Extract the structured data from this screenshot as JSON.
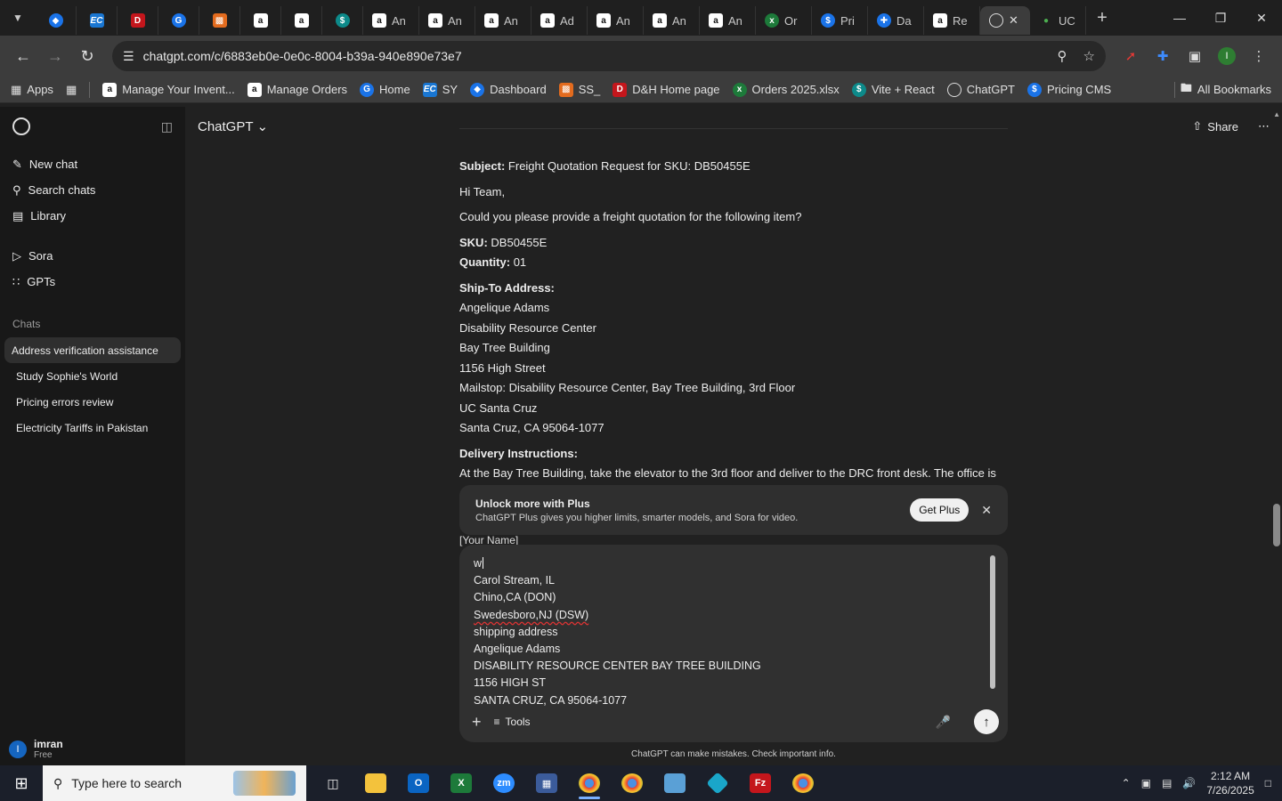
{
  "browser": {
    "tabs": [
      {
        "icon": "blue-diamond-icon",
        "label": ""
      },
      {
        "icon": "ec-icon",
        "label": ""
      },
      {
        "icon": "dh-icon",
        "label": ""
      },
      {
        "icon": "google-docs-icon",
        "label": ""
      },
      {
        "icon": "package-icon",
        "label": ""
      },
      {
        "icon": "amazon-icon",
        "label": ""
      },
      {
        "icon": "amazon-icon",
        "label": ""
      },
      {
        "icon": "pricing-icon",
        "label": ""
      },
      {
        "icon": "amazon-icon",
        "label": "An"
      },
      {
        "icon": "amazon-icon",
        "label": "An"
      },
      {
        "icon": "amazon-icon",
        "label": "An"
      },
      {
        "icon": "amazon-icon",
        "label": "Ad"
      },
      {
        "icon": "amazon-icon",
        "label": "An"
      },
      {
        "icon": "amazon-icon",
        "label": "An"
      },
      {
        "icon": "amazon-icon",
        "label": "An"
      },
      {
        "icon": "excel-icon",
        "label": "Or"
      },
      {
        "icon": "pricing-icon",
        "label": "Pri"
      },
      {
        "icon": "dashboard-icon",
        "label": "Da"
      },
      {
        "icon": "amazon-icon",
        "label": "Re"
      }
    ],
    "active_tab_icon": "chatgpt-icon",
    "last_tab_label": "UC",
    "url": "chatgpt.com/c/6883eb0e-0e0c-8004-b39a-940e890e73e7",
    "bookmarks": [
      "Apps",
      "Manage Your Invent...",
      "Manage Orders",
      "Home",
      "SY",
      "Dashboard",
      "SS_",
      "D&H Home page",
      "Orders 2025.xlsx",
      "Vite + React",
      "ChatGPT",
      "Pricing CMS"
    ],
    "all_bookmarks": "All Bookmarks"
  },
  "sidebar": {
    "items": [
      {
        "label": "New chat",
        "icon": "edit-icon"
      },
      {
        "label": "Search chats",
        "icon": "search-icon"
      },
      {
        "label": "Library",
        "icon": "library-icon"
      },
      {
        "label": "Sora",
        "icon": "play-icon"
      },
      {
        "label": "GPTs",
        "icon": "grid-icon"
      }
    ],
    "chats_label": "Chats",
    "chats": [
      "Address verification assistance",
      "Study Sophie's World",
      "Pricing errors review",
      "Electricity Tariffs in Pakistan"
    ],
    "user": {
      "initial": "I",
      "name": "imran",
      "plan": "Free"
    }
  },
  "header": {
    "model": "ChatGPT",
    "share": "Share"
  },
  "message": {
    "subject_label": "Subject:",
    "subject": "Freight Quotation Request for SKU: DB50455E",
    "greeting": "Hi Team,",
    "intro": "Could you please provide a freight quotation for the following item?",
    "sku_label": "SKU:",
    "sku": "DB50455E",
    "qty_label": "Quantity:",
    "qty": "01",
    "ship_label": "Ship-To Address:",
    "address": [
      "Angelique Adams",
      "Disability Resource Center",
      "Bay Tree Building",
      "1156 High Street",
      "Mailstop: Disability Resource Center, Bay Tree Building, 3rd Floor",
      "UC Santa Cruz",
      "Santa Cruz, CA 95064-1077"
    ],
    "delivery_label": "Delivery Instructions:",
    "delivery": "At the Bay Tree Building, take the elevator to the 3rd floor and deliver to the DRC front desk. The office is",
    "signature_peek": "[Your Name]"
  },
  "upsell": {
    "title": "Unlock more with Plus",
    "desc": "ChatGPT Plus gives you higher limits, smarter models, and Sora for video.",
    "button": "Get Plus"
  },
  "composer": {
    "lines": [
      "w",
      "Carol Stream, IL",
      "Chino,CA (DON)",
      "Swedesboro,NJ (DSW)",
      "shipping address",
      "Angelique Adams",
      "DISABILITY RESOURCE CENTER BAY TREE BUILDING",
      "1156 HIGH ST",
      "SANTA CRUZ, CA  95064-1077"
    ],
    "tools": "Tools"
  },
  "disclaimer": "ChatGPT can make mistakes. Check important info.",
  "taskbar": {
    "search_placeholder": "Type here to search",
    "time": "2:12 AM",
    "date": "7/26/2025"
  }
}
